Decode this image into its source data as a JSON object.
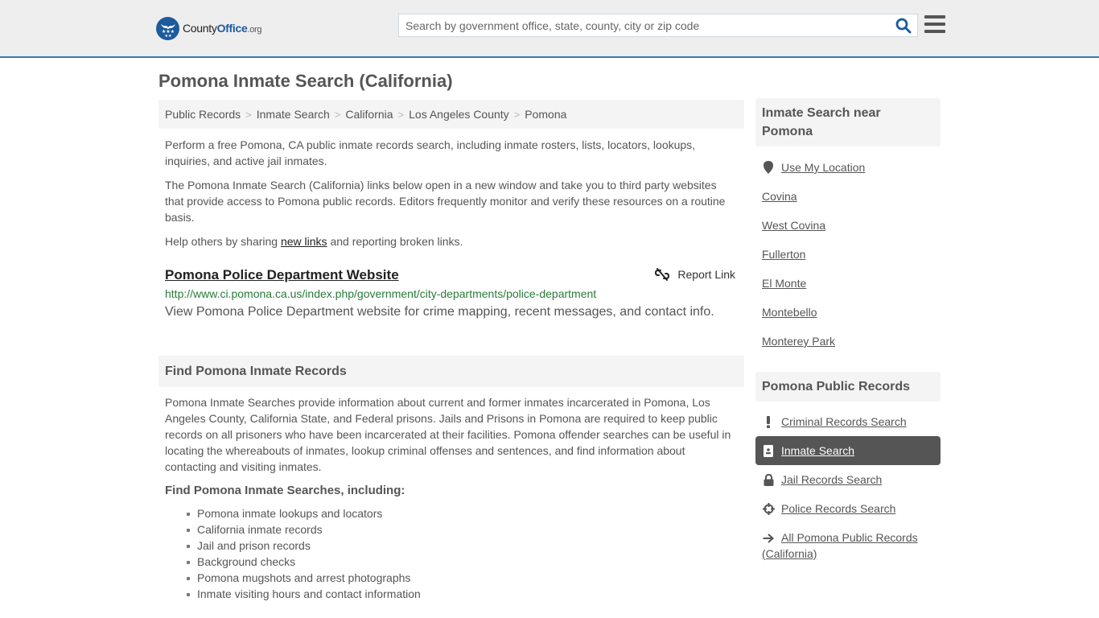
{
  "header": {
    "logo": {
      "brand_primary": "County",
      "brand_accent": "Office",
      "tld": ".org"
    },
    "search": {
      "placeholder": "Search by government office, state, county, city or zip code",
      "value": ""
    },
    "colors": {
      "accent": "#1d5b9c",
      "header_bg": "#eeeeee",
      "header_border": "#3a7db0"
    }
  },
  "page": {
    "title": "Pomona Inmate Search (California)"
  },
  "breadcrumb": [
    {
      "label": "Public Records"
    },
    {
      "label": "Inmate Search"
    },
    {
      "label": "California"
    },
    {
      "label": "Los Angeles County"
    },
    {
      "label": "Pomona"
    }
  ],
  "intro": {
    "p1": "Perform a free Pomona, CA public inmate records search, including inmate rosters, lists, locators, lookups, inquiries, and active jail inmates.",
    "p2": "The Pomona Inmate Search (California) links below open in a new window and take you to third party websites that provide access to Pomona public records. Editors frequently monitor and verify these resources on a routine basis.",
    "p3_before": "Help others by sharing ",
    "p3_link": "new links",
    "p3_after": " and reporting broken links."
  },
  "links": [
    {
      "title": "Pomona Police Department Website",
      "url": "http://www.ci.pomona.ca.us/index.php/government/city-departments/police-department",
      "description": "View Pomona Police Department website for crime mapping, recent messages, and contact info.",
      "report_label": "Report Link"
    }
  ],
  "find_section": {
    "heading": "Find Pomona Inmate Records",
    "body": "Pomona Inmate Searches provide information about current and former inmates incarcerated in Pomona, Los Angeles County, California State, and Federal prisons. Jails and Prisons in Pomona are required to keep public records on all prisoners who have been incarcerated at their facilities. Pomona offender searches can be useful in locating the whereabouts of inmates, lookup criminal offenses and sentences, and find information about contacting and visiting inmates.",
    "subheading": "Find Pomona Inmate Searches, including:",
    "bullets": [
      "Pomona inmate lookups and locators",
      "California inmate records",
      "Jail and prison records",
      "Background checks",
      "Pomona mugshots and arrest photographs",
      "Inmate visiting hours and contact information"
    ]
  },
  "sidebar": {
    "nearby": {
      "heading": "Inmate Search near Pomona",
      "use_location": {
        "label": "Use My Location",
        "icon": "map-marker-icon"
      },
      "cities": [
        "Covina",
        "West Covina",
        "Fullerton",
        "El Monte",
        "Montebello",
        "Monterey Park"
      ]
    },
    "records": {
      "heading": "Pomona Public Records",
      "items": [
        {
          "label": "Criminal Records Search",
          "icon": "exclamation-icon",
          "active": false
        },
        {
          "label": "Inmate Search",
          "icon": "id-badge-icon",
          "active": true
        },
        {
          "label": "Jail Records Search",
          "icon": "lock-icon",
          "active": false
        },
        {
          "label": "Police Records Search",
          "icon": "crosshairs-icon",
          "active": false
        },
        {
          "label": "All Pomona Public Records (California)",
          "icon": "arrow-right-icon",
          "active": false
        }
      ]
    }
  }
}
